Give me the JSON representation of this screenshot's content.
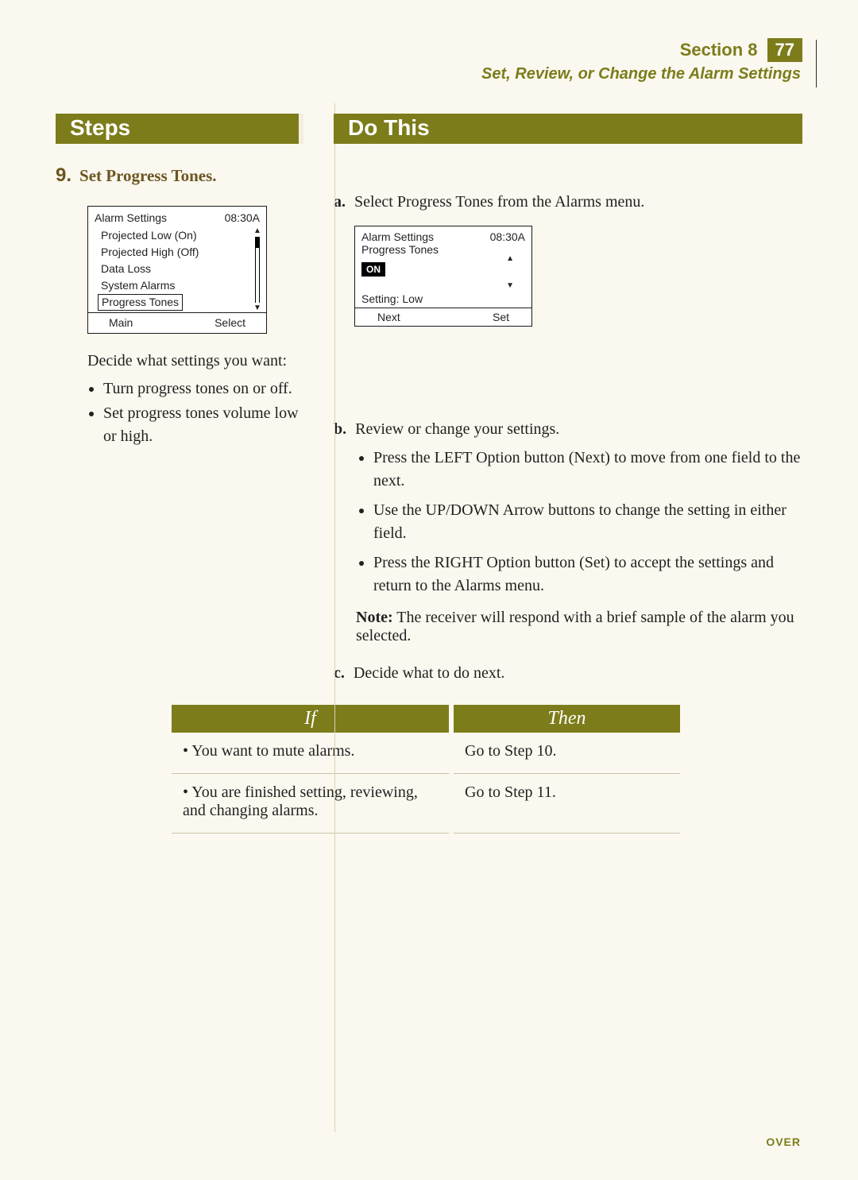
{
  "header": {
    "section_label": "Section 8",
    "page_number": "77",
    "subtitle": "Set, Review, or Change the Alarm Settings"
  },
  "bands": {
    "steps": "Steps",
    "do_this": "Do This"
  },
  "step": {
    "number": "9.",
    "title": "Set Progress Tones."
  },
  "lcd1": {
    "title": "Alarm Settings",
    "time": "08:30A",
    "items": [
      "Projected Low  (On)",
      "Projected High  (Off)",
      "Data Loss",
      "System Alarms",
      "Progress Tones"
    ],
    "soft_left": "Main",
    "soft_right": "Select"
  },
  "decide": {
    "intro": "Decide what settings you want:",
    "bullets": [
      "Turn progress tones on or off.",
      "Set progress tones volume low or high."
    ]
  },
  "sub_a": {
    "letter": "a.",
    "text": "Select Progress Tones from the Alarms menu."
  },
  "lcd2": {
    "title": "Alarm Settings",
    "time": "08:30A",
    "second": "Progress Tones",
    "on": "ON",
    "setting": "Setting: Low",
    "soft_left": "Next",
    "soft_right": "Set"
  },
  "sub_b": {
    "letter": "b.",
    "text": "Review or change your settings.",
    "bullets": [
      "Press the LEFT Option button (Next) to move from one field to the next.",
      "Use the UP/DOWN Arrow buttons to change the setting in either field.",
      "Press the RIGHT Option button (Set) to accept the settings and return to the Alarms menu."
    ],
    "note_label": "Note:",
    "note_text": " The receiver will respond with a brief sample of the alarm you selected."
  },
  "sub_c": {
    "letter": "c.",
    "text": "Decide what to do next."
  },
  "table": {
    "head_if": "If",
    "head_then": "Then",
    "rows": [
      {
        "if": "You want to mute alarms.",
        "then": "Go to Step 10."
      },
      {
        "if": "You are finished setting, reviewing, and changing alarms.",
        "then": "Go to Step 11."
      }
    ]
  },
  "footer": {
    "over": "OVER"
  }
}
